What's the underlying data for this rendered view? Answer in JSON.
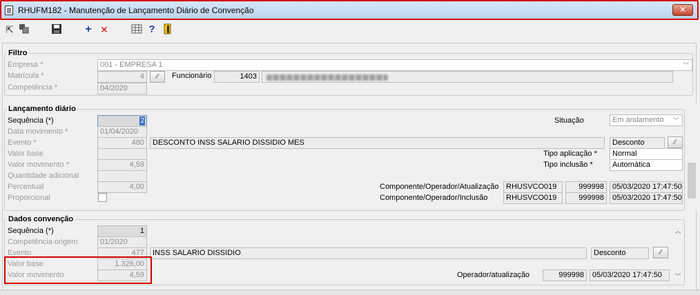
{
  "window": {
    "title": "RHUFM182 - Manutenção de Lançamento Diário de Convenção",
    "close_label": "✕"
  },
  "toolbar": {
    "icons": [
      "first-record-icon",
      "copy-icon",
      "save-icon",
      "add-icon",
      "delete-icon",
      "grid-icon",
      "help-icon",
      "exit-icon"
    ]
  },
  "filtro": {
    "legend": "Filtro",
    "empresa_label": "Empresa *",
    "empresa_value": "001 - EMPRESA 1",
    "matricula_label": "Matrícula *",
    "matricula_value": "4",
    "funcionario_label": "Funcionário",
    "funcionario_value": "1403",
    "competencia_label": "Competência *",
    "competencia_value": "04/2020"
  },
  "lancamento": {
    "legend": "Lançamento diário",
    "sequencia_label": "Sequência (*)",
    "sequencia_value": "2",
    "data_movimento_label": "Data movimento *",
    "data_movimento_value": "01/04/2020",
    "evento_label": "Evento *",
    "evento_code": "480",
    "evento_desc": "DESCONTO INSS SALARIO DISSIDIO MES",
    "valor_base_label": "Valor base",
    "valor_base_value": "",
    "valor_movimento_label": "Valor movimento *",
    "valor_movimento_value": "4,59",
    "quantidade_label": "Quantidade adicional",
    "percentual_label": "Percentual",
    "percentual_value": "4,00",
    "proporcional_label": "Proporcional",
    "situacao_label": "Situação",
    "situacao_value": "Em andamento",
    "tipo_evento_value": "Desconto",
    "tipo_aplicacao_label": "Tipo aplicação *",
    "tipo_aplicacao_value": "Normal",
    "tipo_inclusao_label": "Tipo inclusão *",
    "tipo_inclusao_value": "Automática",
    "comp_atual_label": "Componente/Operador/Atualização",
    "comp_atual_comp": "RHUSVCO019",
    "comp_atual_oper": "999998",
    "comp_atual_date": "05/03/2020 17:47:50",
    "comp_incl_label": "Componente/Operador/Inclusão",
    "comp_incl_comp": "RHUSVCO019",
    "comp_incl_oper": "999998",
    "comp_incl_date": "05/03/2020 17:47:50"
  },
  "convencao": {
    "legend": "Dados convenção",
    "sequencia_label": "Sequência (*)",
    "sequencia_value": "1",
    "competencia_origem_label": "Competência origem",
    "competencia_origem_value": "01/2020",
    "evento_label": "Evento",
    "evento_code": "477",
    "evento_desc": "INSS SALARIO DISSIDIO",
    "tipo_evento_value": "Desconto",
    "valor_base_label": "Valor base",
    "valor_base_value": "1.326,00",
    "valor_movimento_label": "Valor movimento",
    "valor_movimento_value": "4,59",
    "operador_label": "Operador/atualização",
    "operador_value": "999998",
    "operador_date": "05/03/2020 17:47:50"
  }
}
